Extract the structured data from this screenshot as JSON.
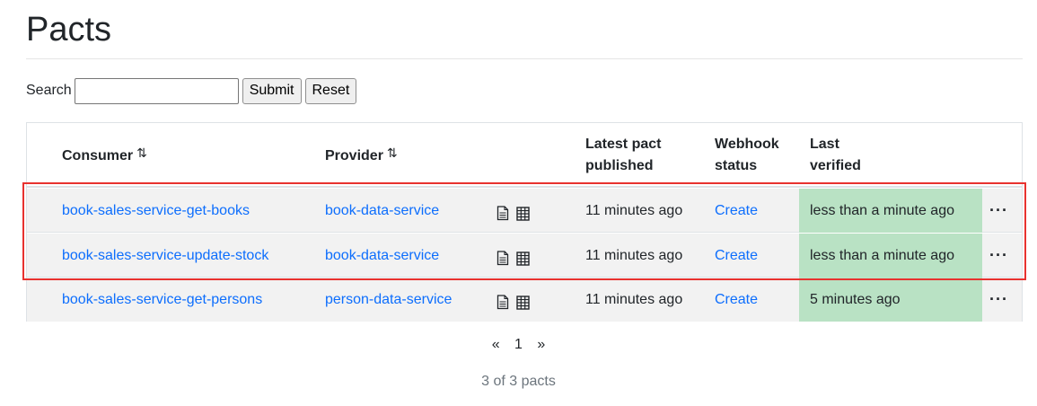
{
  "page": {
    "title": "Pacts"
  },
  "search": {
    "label": "Search",
    "value": "",
    "submit_label": "Submit",
    "reset_label": "Reset"
  },
  "table": {
    "headers": {
      "consumer": "Consumer",
      "provider": "Provider",
      "latest_line1": "Latest pact",
      "latest_line2": "published",
      "webhook_line1": "Webhook",
      "webhook_line2": "status",
      "verified_line1": "Last",
      "verified_line2": "verified",
      "sort_glyph": "⇅"
    },
    "rows": [
      {
        "consumer": "book-sales-service-get-books",
        "provider": "book-data-service",
        "latest": "11 minutes ago",
        "webhook": "Create",
        "verified": "less than a minute ago",
        "more": "···"
      },
      {
        "consumer": "book-sales-service-update-stock",
        "provider": "book-data-service",
        "latest": "11 minutes ago",
        "webhook": "Create",
        "verified": "less than a minute ago",
        "more": "···"
      },
      {
        "consumer": "book-sales-service-get-persons",
        "provider": "person-data-service",
        "latest": "11 minutes ago",
        "webhook": "Create",
        "verified": "5 minutes ago",
        "more": "···"
      }
    ],
    "icons": [
      "document-icon",
      "matrix-icon"
    ],
    "verified_color": "#b9e2c4",
    "link_color": "#0d6efd"
  },
  "highlight": {
    "color": "#e8322f"
  },
  "pagination": {
    "prev": "«",
    "current": "1",
    "next": "»"
  },
  "footer": {
    "count_text": "3 of 3 pacts"
  }
}
